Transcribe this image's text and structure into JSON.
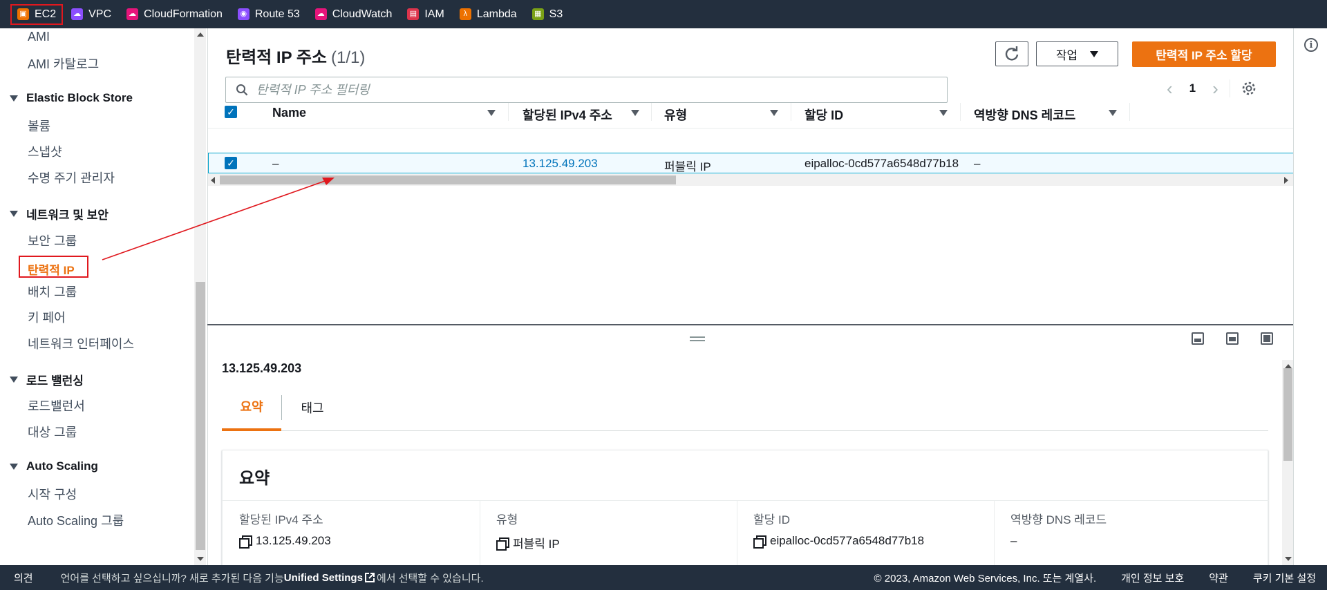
{
  "services": [
    {
      "label": "EC2",
      "icon": "ec2-icon",
      "color": "#ed7100"
    },
    {
      "label": "VPC",
      "icon": "vpc-icon",
      "color": "#8c4fff"
    },
    {
      "label": "CloudFormation",
      "icon": "cloudformation-icon",
      "color": "#e7157b"
    },
    {
      "label": "Route 53",
      "icon": "route53-icon",
      "color": "#8c4fff"
    },
    {
      "label": "CloudWatch",
      "icon": "cloudwatch-icon",
      "color": "#e7157b"
    },
    {
      "label": "IAM",
      "icon": "iam-icon",
      "color": "#dd344c"
    },
    {
      "label": "Lambda",
      "icon": "lambda-icon",
      "color": "#ed7100"
    },
    {
      "label": "S3",
      "icon": "s3-icon",
      "color": "#7aa116"
    }
  ],
  "sidebar": {
    "ami": "AMI",
    "ami_catalog": "AMI 카탈로그",
    "ebs_head": "Elastic Block Store",
    "volumes": "볼륨",
    "snapshots": "스냅샷",
    "lifecycle": "수명 주기 관리자",
    "net_head": "네트워크 및 보안",
    "security_groups": "보안 그룹",
    "elastic_ip": "탄력적 IP",
    "placement_groups": "배치 그룹",
    "key_pairs": "키 페어",
    "network_interfaces": "네트워크 인터페이스",
    "lb_head": "로드 밸런싱",
    "load_balancers": "로드밸런서",
    "target_groups": "대상 그룹",
    "as_head": "Auto Scaling",
    "launch_config": "시작 구성",
    "as_groups": "Auto Scaling 그룹"
  },
  "main": {
    "title": "탄력적 IP 주소",
    "count": "(1/1)",
    "actions_label": "작업",
    "allocate_label": "탄력적 IP 주소 할당",
    "filter_placeholder": "탄력적 IP 주소 필터링",
    "page": "1"
  },
  "table": {
    "columns": [
      "Name",
      "할당된 IPv4 주소",
      "유형",
      "할당 ID",
      "역방향 DNS 레코드"
    ],
    "rows": [
      {
        "name": "–",
        "ipv4": "13.125.49.203",
        "type": "퍼블릭 IP",
        "allocation_id": "eipalloc-0cd577a6548d77b18",
        "reverse_dns": "–"
      }
    ]
  },
  "detail": {
    "title": "13.125.49.203",
    "tabs": [
      "요약",
      "태그"
    ],
    "card_title": "요약",
    "fields": [
      {
        "label": "할당된 IPv4 주소",
        "value": "13.125.49.203"
      },
      {
        "label": "유형",
        "value": "퍼블릭 IP"
      },
      {
        "label": "할당 ID",
        "value": "eipalloc-0cd577a6548d77b18"
      },
      {
        "label": "역방향 DNS 레코드",
        "value": "–"
      }
    ]
  },
  "footer": {
    "feedback": "의견",
    "lang_prefix": "언어를 선택하고 싶으십니까? 새로 추가된 다음 기능",
    "unified": "Unified Settings",
    "lang_suffix": "에서 선택할 수 있습니다.",
    "copyright": "© 2023, Amazon Web Services, Inc. 또는 계열사.",
    "privacy": "개인 정보 보호",
    "terms": "약관",
    "cookies": "쿠키 기본 설정"
  },
  "colors": {
    "accent": "#ec7211",
    "link": "#0073bb",
    "annotation": "#e0181e"
  }
}
